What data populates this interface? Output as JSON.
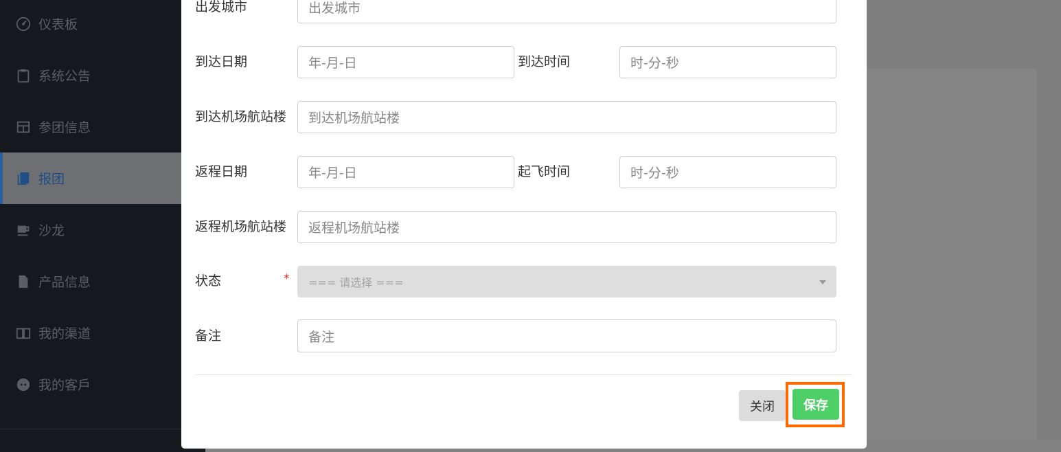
{
  "sidebar": {
    "items": [
      {
        "label": "仪表板",
        "icon": "dashboard-icon"
      },
      {
        "label": "系统公告",
        "icon": "clipboard-icon"
      },
      {
        "label": "参团信息",
        "icon": "table-icon"
      },
      {
        "label": "报团",
        "icon": "book-icon",
        "active": true
      },
      {
        "label": "沙龙",
        "icon": "coffee-icon"
      },
      {
        "label": "产品信息",
        "icon": "file-icon"
      },
      {
        "label": "我的渠道",
        "icon": "open-book-icon"
      },
      {
        "label": "我的客戶",
        "icon": "face-icon"
      }
    ]
  },
  "form": {
    "departure_city": {
      "label": "出发城市",
      "placeholder": "出发城市"
    },
    "arrival_date": {
      "label": "到达日期",
      "placeholder": "年-月-日"
    },
    "arrival_time": {
      "label": "到达时间",
      "placeholder": "时-分-秒"
    },
    "arrival_terminal": {
      "label": "到达机场航站楼",
      "placeholder": "到达机场航站楼"
    },
    "return_date": {
      "label": "返程日期",
      "placeholder": "年-月-日"
    },
    "departure_time": {
      "label": "起飞时间",
      "placeholder": "时-分-秒"
    },
    "return_terminal": {
      "label": "返程机场航站楼",
      "placeholder": "返程机场航站楼"
    },
    "status": {
      "label": "状态",
      "required_mark": "*",
      "selected": "=== 请选择 ==="
    },
    "remarks": {
      "label": "备注",
      "placeholder": "备注"
    }
  },
  "buttons": {
    "close_label": "关闭",
    "save_label": "保存"
  },
  "colors": {
    "save_button": "#4fcf68",
    "highlight": "#ff6a00",
    "sidebar_active": "#2b5fa0"
  }
}
